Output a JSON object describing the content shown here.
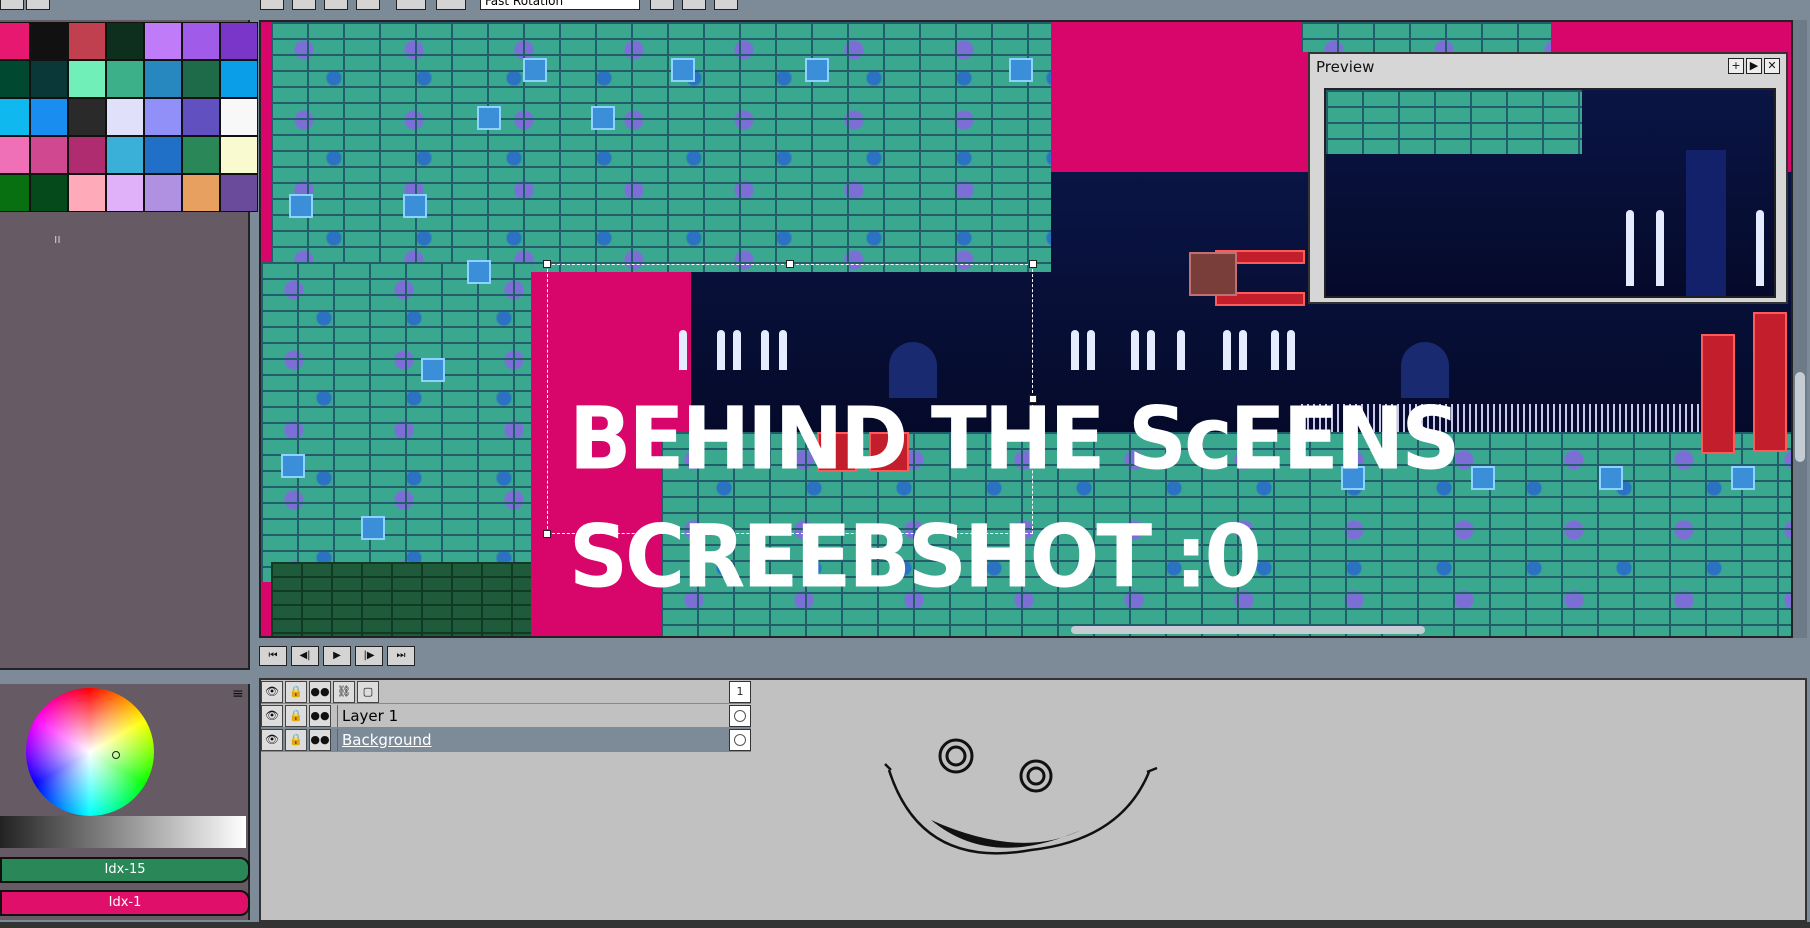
{
  "toolbar": {
    "rotation_combo": "Fast Rotation"
  },
  "palette": {
    "colors": [
      "#e61870",
      "#111111",
      "#c04050",
      "#0e2f1e",
      "#c07cf8",
      "#a05ce8",
      "#7a36c8",
      "#004830",
      "#0a3838",
      "#70f0b8",
      "#3cb088",
      "#2688bf",
      "#1e6b4a",
      "#0a9ee8",
      "#10b8f0",
      "#1a8ef0",
      "#2a2a2a",
      "#e0e0fa",
      "#9090f8",
      "#6050c0",
      "#f8f8f8",
      "#f070b8",
      "#d04890",
      "#b02c70",
      "#3ab0d8",
      "#2070c8",
      "#2a8858",
      "#fafad0",
      "#087010",
      "#044a1a",
      "#ffaab8",
      "#e0b0f8",
      "#b090e0",
      "#e8a060",
      "#6a4a9a"
    ],
    "grip_label": "ıı"
  },
  "color_panel": {
    "menu_icon": "≡",
    "fg_label": "Idx-15",
    "bg_label": "Idx-1",
    "fg_color": "#2a8858",
    "bg_color": "#e0106a"
  },
  "canvas": {
    "line1": "BEHIND THE ScEENS",
    "line2": "SCREEBSHOT :0"
  },
  "preview": {
    "title": "Preview",
    "buttons": [
      "+",
      "▶",
      "✕"
    ]
  },
  "animation": {
    "buttons": [
      "⏮",
      "◀|",
      "▶",
      "|▶",
      "⏭"
    ]
  },
  "timeline": {
    "frame_number": "1",
    "layers": [
      {
        "name": "Layer 1",
        "active": false
      },
      {
        "name": "Background",
        "active": true
      }
    ]
  }
}
